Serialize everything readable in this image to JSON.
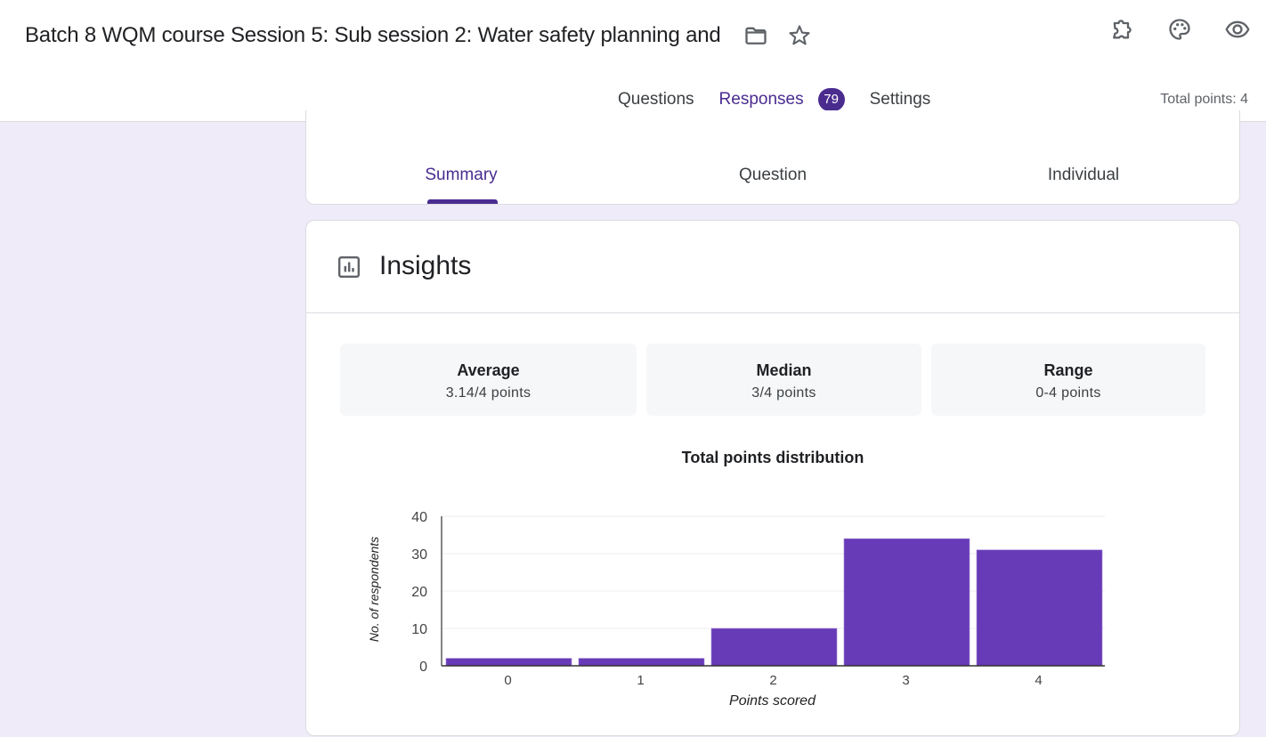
{
  "header": {
    "title": "Batch 8 WQM course  Session 5: Sub session 2: Water safety planning and",
    "icons": [
      "folder-icon",
      "star-icon",
      "addon-puzzle-icon",
      "palette-icon",
      "eye-preview-icon"
    ]
  },
  "tabs": [
    {
      "label": "Questions",
      "active": false
    },
    {
      "label": "Responses",
      "active": true,
      "badge": "79"
    },
    {
      "label": "Settings",
      "active": false
    }
  ],
  "total_points": "Total points: 4",
  "subtabs": [
    {
      "label": "Summary",
      "active": true
    },
    {
      "label": "Question",
      "active": false
    },
    {
      "label": "Individual",
      "active": false
    }
  ],
  "insights": {
    "title": "Insights",
    "stats": [
      {
        "name": "Average",
        "value": "3.14/4 points"
      },
      {
        "name": "Median",
        "value": "3/4 points"
      },
      {
        "name": "Range",
        "value": "0-4 points"
      }
    ]
  },
  "colors": {
    "accent": "#4a2c8f",
    "bar": "#673ab7",
    "page_bg": "#efebf8"
  },
  "chart_data": {
    "type": "bar",
    "title": "Total points distribution",
    "xlabel": "Points scored",
    "ylabel": "No. of respondents",
    "categories": [
      "0",
      "1",
      "2",
      "3",
      "4"
    ],
    "values": [
      2,
      2,
      10,
      34,
      31
    ],
    "ylim": [
      0,
      40
    ],
    "yticks": [
      0,
      10,
      20,
      30,
      40
    ],
    "grid": true,
    "legend": "none"
  }
}
